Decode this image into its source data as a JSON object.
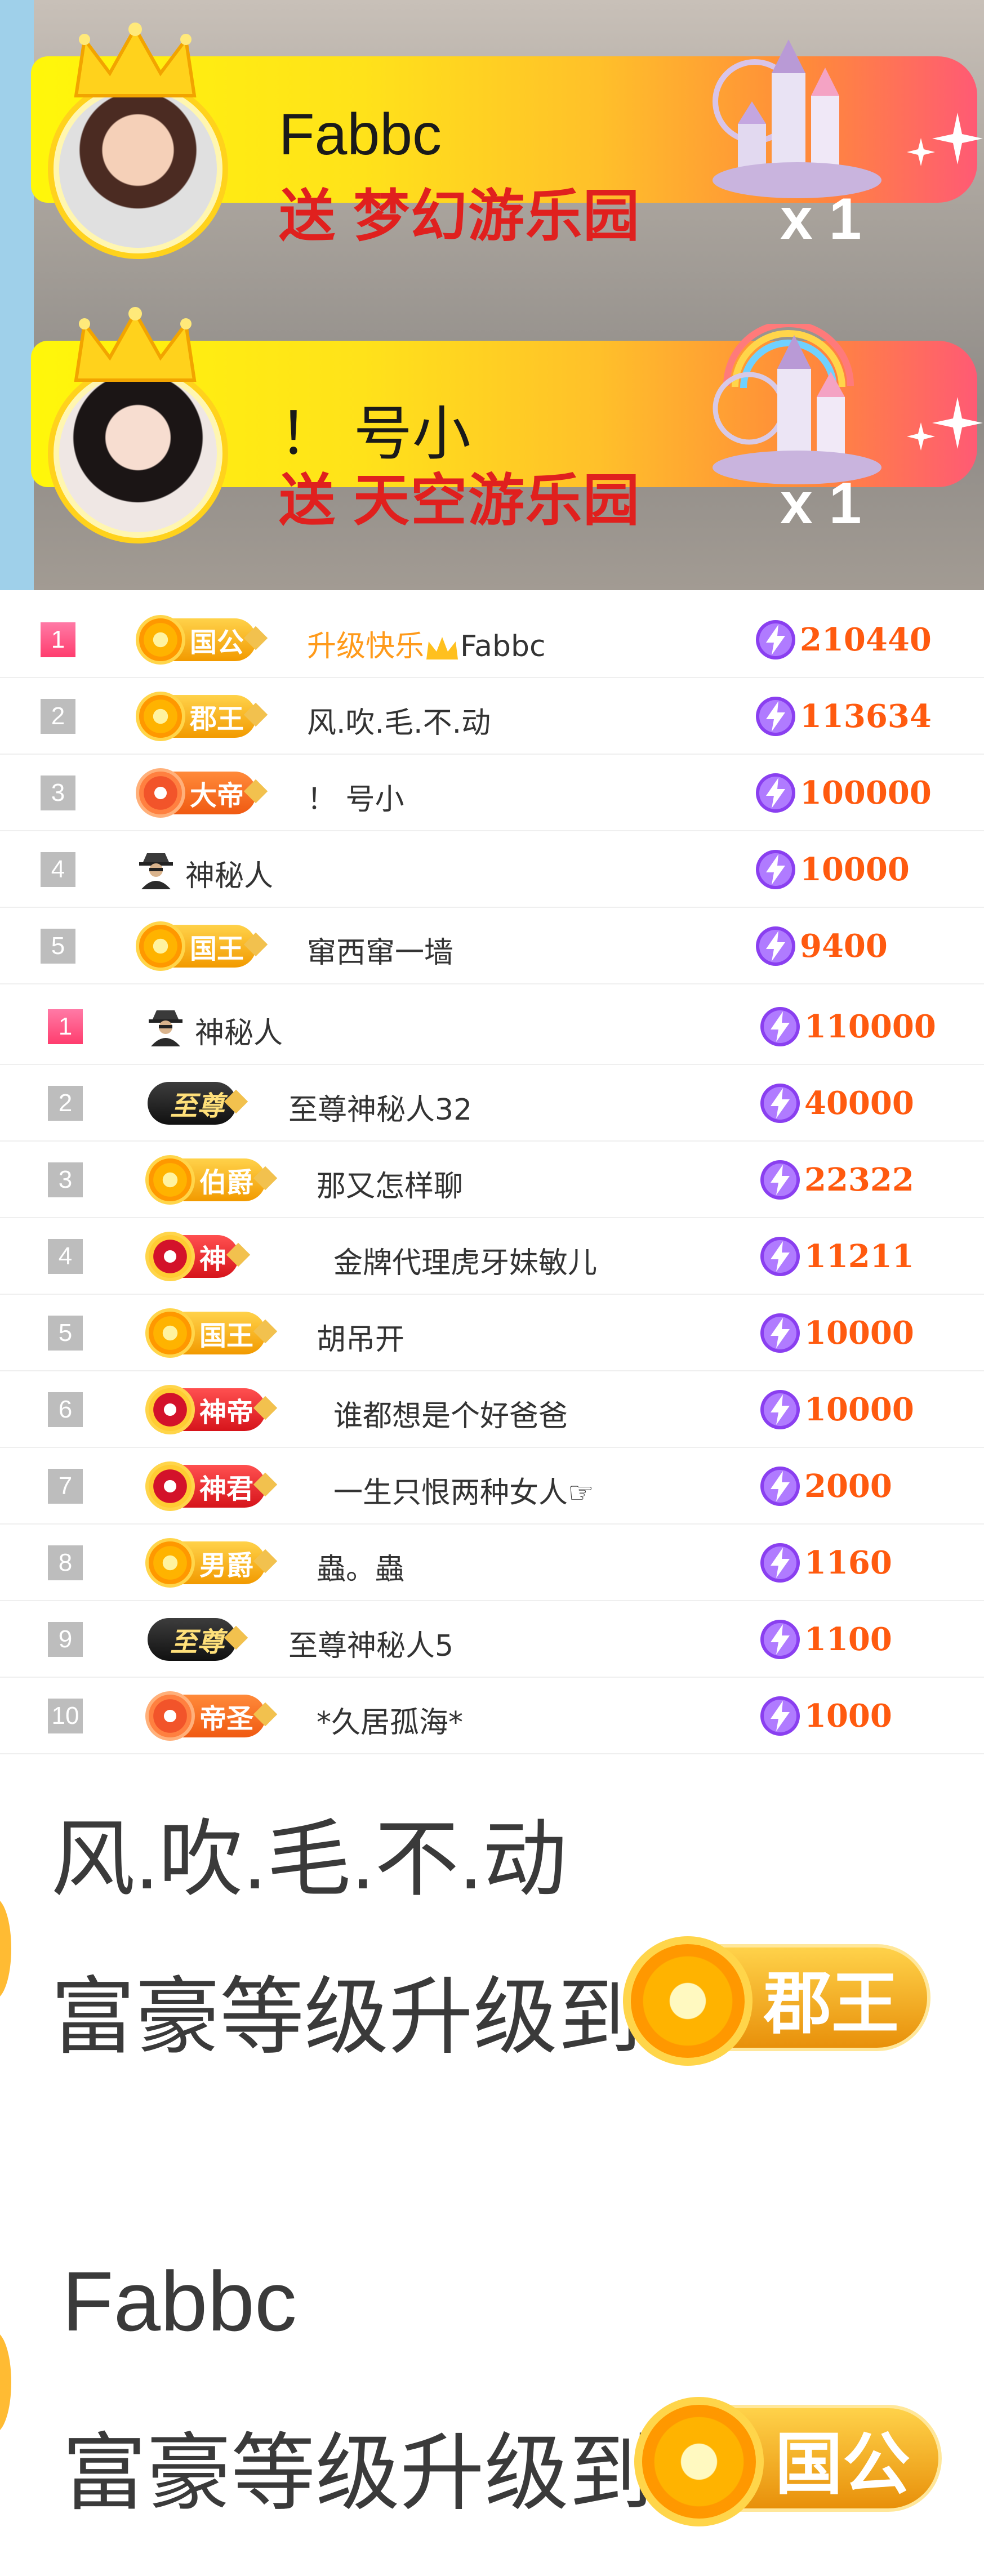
{
  "gift_banners": [
    {
      "sender": "Fabbc",
      "action": "送",
      "gift": "梦幻游乐园",
      "quantity": "x 1"
    },
    {
      "sender": "！ 号小",
      "action": "送",
      "gift": "天空游乐园",
      "quantity": "x 1"
    }
  ],
  "rank_list_1": [
    {
      "rank": "1",
      "badge": "国公",
      "badge_style": "gold",
      "prefix": "升级快乐",
      "name": "Fabbc",
      "score": "210440"
    },
    {
      "rank": "2",
      "badge": "郡王",
      "badge_style": "gold",
      "name": "风.吹.毛.不.动",
      "score": "113634"
    },
    {
      "rank": "3",
      "badge": "大帝",
      "badge_style": "orange",
      "name": "！ 号小",
      "score": "100000"
    },
    {
      "rank": "4",
      "badge": "",
      "badge_style": "mystery",
      "name": "神秘人",
      "score": "10000"
    },
    {
      "rank": "5",
      "badge": "国王",
      "badge_style": "gold",
      "name": "窜西窜一墙",
      "score": "9400"
    }
  ],
  "rank_list_2": [
    {
      "rank": "1",
      "badge": "",
      "badge_style": "mystery",
      "name": "神秘人",
      "score": "110000"
    },
    {
      "rank": "2",
      "badge": "至尊",
      "badge_style": "black",
      "name": "至尊神秘人32",
      "score": "40000"
    },
    {
      "rank": "3",
      "badge": "伯爵",
      "badge_style": "gold",
      "name": "那又怎样聊",
      "score": "22322"
    },
    {
      "rank": "4",
      "badge": "神",
      "badge_style": "red",
      "name": "金牌代理虎牙妹敏儿",
      "score": "11211"
    },
    {
      "rank": "5",
      "badge": "国王",
      "badge_style": "gold",
      "name": "胡吊开",
      "score": "10000"
    },
    {
      "rank": "6",
      "badge": "神帝",
      "badge_style": "red",
      "name": "谁都想是个好爸爸",
      "score": "10000"
    },
    {
      "rank": "7",
      "badge": "神君",
      "badge_style": "red",
      "name": "一生只恨两种女人☞",
      "score": "2000"
    },
    {
      "rank": "8",
      "badge": "男爵",
      "badge_style": "gold",
      "name": "蟲。蟲",
      "score": "1160"
    },
    {
      "rank": "9",
      "badge": "至尊",
      "badge_style": "black",
      "name": "至尊神秘人5",
      "score": "1100"
    },
    {
      "rank": "10",
      "badge": "帝圣",
      "badge_style": "orange",
      "name": "*久居孤海*",
      "score": "1000"
    }
  ],
  "level_up_notices": [
    {
      "name": "风.吹.毛.不.动",
      "text": "富豪等级升级到",
      "badge": "郡王"
    },
    {
      "name": "Fabbc",
      "text": "富豪等级升级到",
      "badge": "国公"
    }
  ],
  "colors": {
    "score": "#ff5a0f",
    "first_rank": "#ff3d6e",
    "gift_text": "#e0201e"
  }
}
